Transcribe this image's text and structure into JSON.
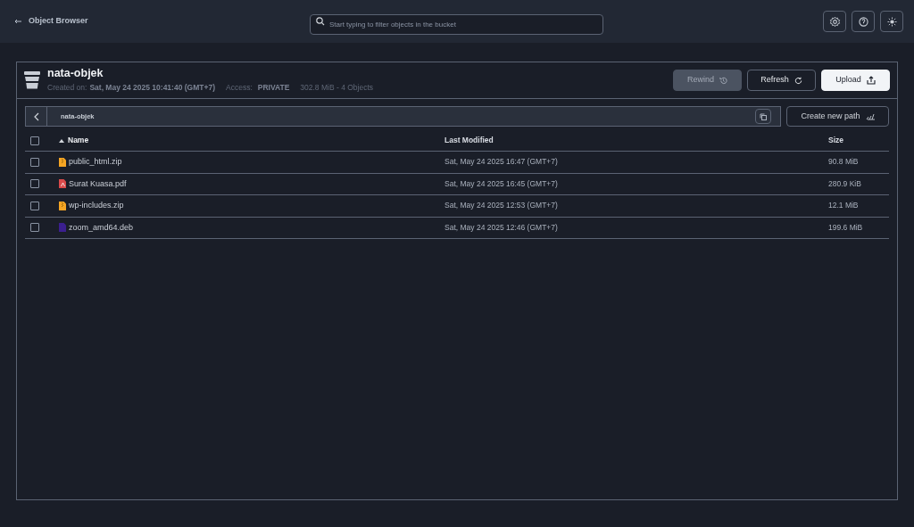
{
  "topbar": {
    "back_label": "Object Browser",
    "search": {
      "placeholder": "Start typing to filter objects in the bucket"
    }
  },
  "bucket": {
    "name": "nata-objek",
    "created_label": "Created on:",
    "created": "Sat, May 24 2025 10:41:40 (GMT+7)",
    "access_label": "Access:",
    "access": "PRIVATE",
    "summary": "302.8 MiB - 4 Objects"
  },
  "actions": [
    {
      "label": "Rewind",
      "kind": "rewind",
      "disabled": true
    },
    {
      "label": "Refresh",
      "kind": "refresh",
      "disabled": false
    },
    {
      "label": "Upload",
      "kind": "upload",
      "disabled": false
    }
  ],
  "breadcrumb": {
    "path": "nata-objek",
    "new_path_label": "Create new path"
  },
  "table": {
    "columns": [
      {
        "label": "Name",
        "sorted": true
      },
      {
        "label": "Last Modified",
        "sorted": false
      },
      {
        "label": "Size",
        "sorted": false
      }
    ],
    "select_all": {
      "checked": false
    },
    "rows": [
      {
        "name": "public_html.zip",
        "kind": "zip",
        "modified": "Sat, May 24 2025 16:47 (GMT+7)",
        "size": "90.8 MiB",
        "checked": false
      },
      {
        "name": "Surat Kuasa.pdf",
        "kind": "pdf",
        "modified": "Sat, May 24 2025 16:45 (GMT+7)",
        "size": "280.9 KiB",
        "checked": false
      },
      {
        "name": "wp-includes.zip",
        "kind": "zip",
        "modified": "Sat, May 24 2025 12:53 (GMT+7)",
        "size": "12.1 MiB",
        "checked": false
      },
      {
        "name": "zoom_amd64.deb",
        "kind": "deb",
        "modified": "Sat, May 24 2025 12:46 (GMT+7)",
        "size": "199.6 MiB",
        "checked": false
      }
    ]
  }
}
